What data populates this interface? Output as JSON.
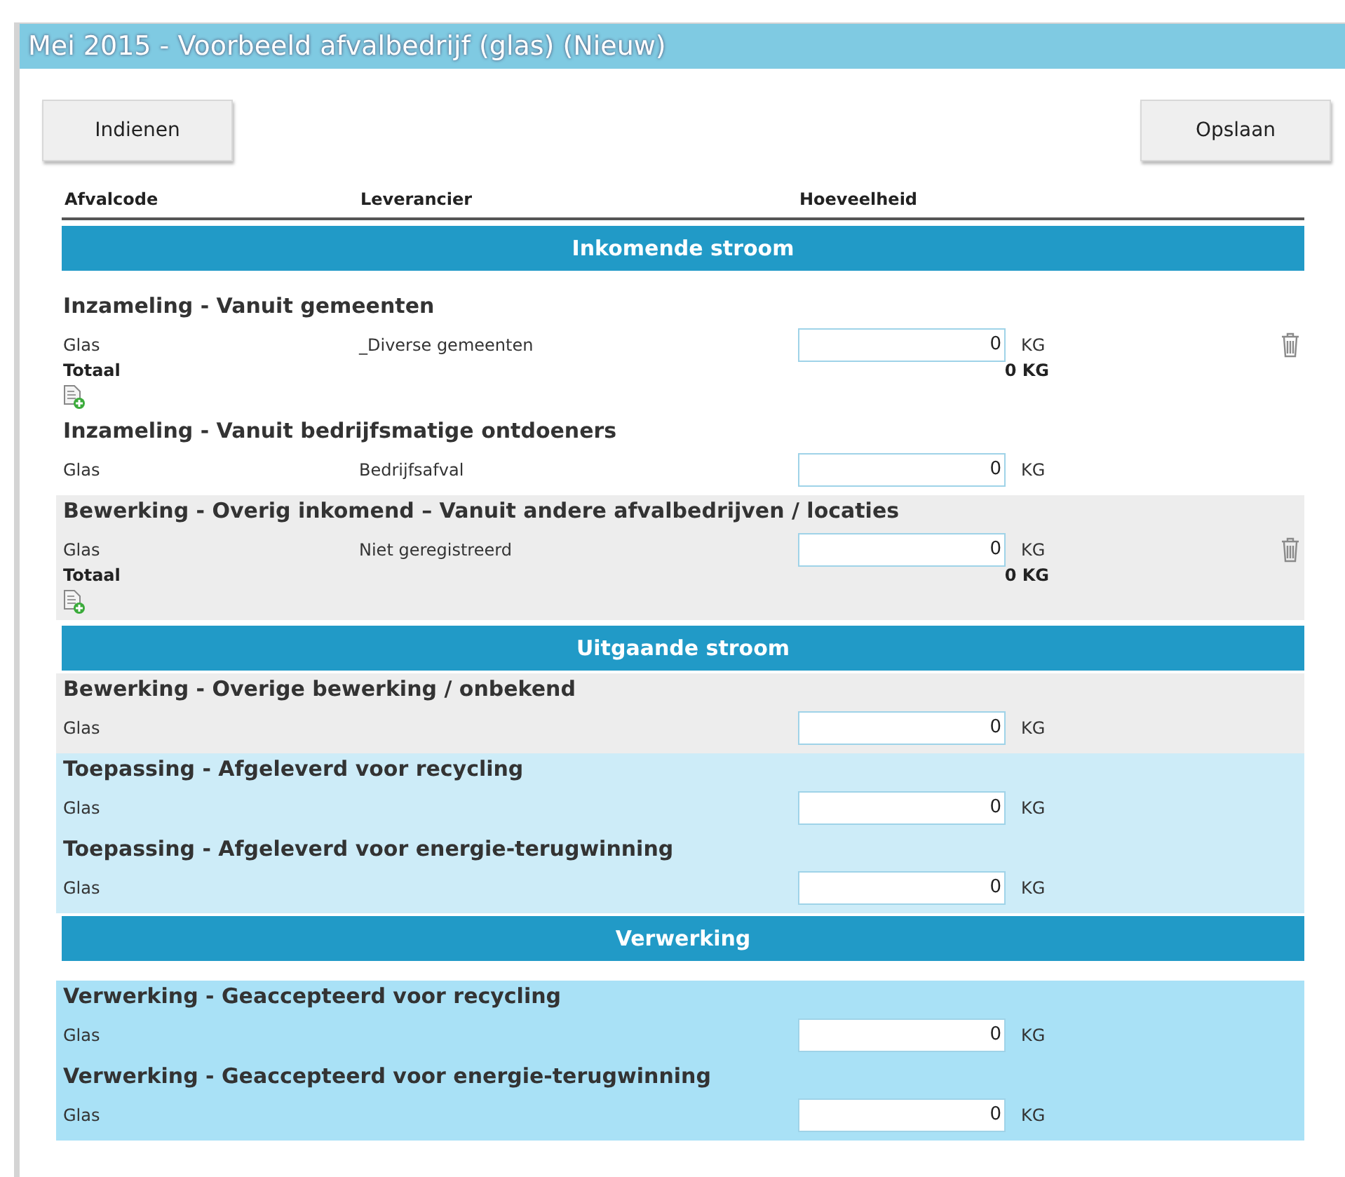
{
  "window": {
    "title": "Mei 2015 - Voorbeeld afvalbedrijf (glas) (Nieuw)"
  },
  "buttons": {
    "submit": "Indienen",
    "save": "Opslaan"
  },
  "columns": [
    "Afvalcode",
    "Leverancier",
    "Hoeveelheid"
  ],
  "sections": [
    {
      "title": "Inkomende stroom",
      "groups": [
        {
          "kind": "plain",
          "title": "Inzameling - Vanuit gemeenten",
          "rows": [
            {
              "code": "Glas",
              "supplier": "_Diverse gemeenten",
              "value": "0",
              "unit": "KG",
              "deletable": true
            }
          ],
          "total": {
            "label": "Totaal",
            "value": "0 KG"
          },
          "can_add": true
        },
        {
          "kind": "plain",
          "title": "Inzameling - Vanuit bedrijfsmatige ontdoeners",
          "rows": [
            {
              "code": "Glas",
              "supplier": "Bedrijfsafval",
              "value": "0",
              "unit": "KG",
              "deletable": false
            }
          ],
          "can_add": false
        },
        {
          "kind": "grey",
          "title": "Bewerking - Overig inkomend – Vanuit andere afvalbedrijven / locaties",
          "rows": [
            {
              "code": "Glas",
              "supplier": "Niet geregistreerd",
              "value": "0",
              "unit": "KG",
              "deletable": true
            }
          ],
          "total": {
            "label": "Totaal",
            "value": "0 KG"
          },
          "can_add": true
        }
      ]
    },
    {
      "title": "Uitgaande stroom",
      "groups": [
        {
          "kind": "grey",
          "title": "Bewerking - Overige bewerking / onbekend",
          "rows": [
            {
              "code": "Glas",
              "value": "0",
              "unit": "KG",
              "deletable": false
            }
          ],
          "can_add": false
        },
        {
          "kind": "pale",
          "title": "Toepassing - Afgeleverd voor recycling",
          "rows": [
            {
              "code": "Glas",
              "value": "0",
              "unit": "KG",
              "deletable": false
            }
          ],
          "can_add": false
        },
        {
          "kind": "pale",
          "title": "Toepassing - Afgeleverd voor energie-terugwinning",
          "rows": [
            {
              "code": "Glas",
              "value": "0",
              "unit": "KG",
              "deletable": false
            }
          ],
          "can_add": false
        }
      ]
    },
    {
      "title": "Verwerking",
      "groups": [
        {
          "kind": "sky",
          "title": "Verwerking - Geaccepteerd voor recycling",
          "rows": [
            {
              "code": "Glas",
              "value": "0",
              "unit": "KG",
              "deletable": false
            }
          ],
          "can_add": false
        },
        {
          "kind": "sky",
          "title": "Verwerking - Geaccepteerd voor energie-terugwinning",
          "rows": [
            {
              "code": "Glas",
              "value": "0",
              "unit": "KG",
              "deletable": false
            }
          ],
          "can_add": false
        }
      ]
    }
  ]
}
